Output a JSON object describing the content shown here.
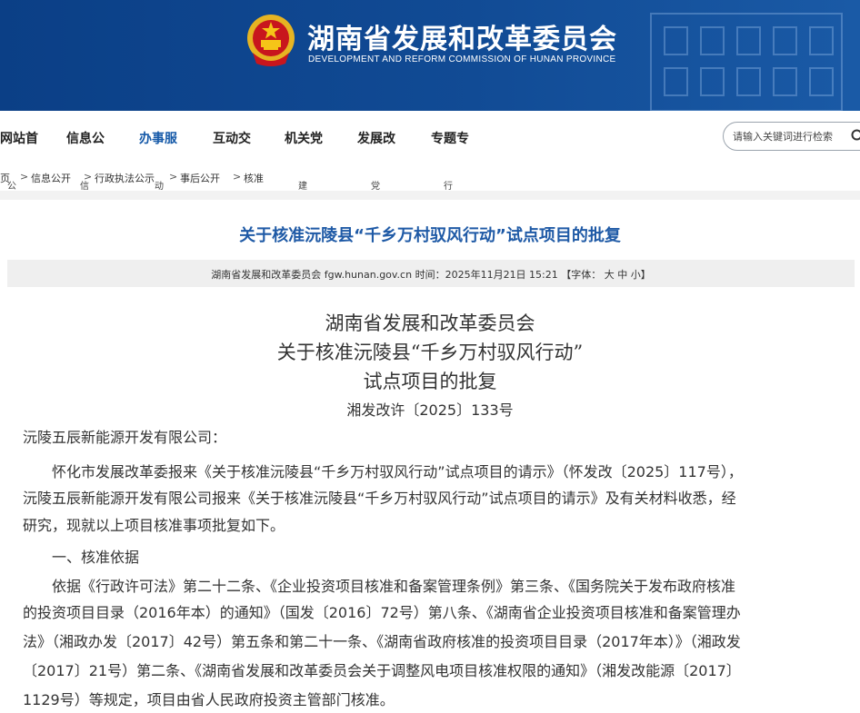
{
  "header": {
    "title": "湖南省发展和改革委员会",
    "subtitle": "DEVELOPMENT AND REFORM COMMISSION OF HUNAN PROVINCE",
    "brand_color": "#0b3f86"
  },
  "nav": {
    "items": [
      "网站首",
      "信息公",
      "办事服",
      "互动交",
      "机关党",
      "发展改",
      "专题专"
    ],
    "active_index": 2,
    "search_placeholder": "请输入关键词进行检索"
  },
  "breadcrumb": {
    "items": [
      "页",
      "信息公开",
      "行政执法公示",
      "事后公开",
      "核准"
    ],
    "separator": ">",
    "ghost": [
      "公",
      "信",
      "动",
      "建",
      "党",
      "行"
    ]
  },
  "article": {
    "title": "关于核准沅陵县“千乡万村驭风行动”试点项目的批复",
    "meta": "湖南省发展和改革委员会 fgw.hunan.gov.cn  时间：2025年11月21日 15:21   【字体：  大  中  小】",
    "doc_heading": [
      "湖南省发展和改革委员会",
      "关于核准沅陵县“千乡万村驭风行动”",
      "试点项目的批复"
    ],
    "doc_number": "湘发改许〔2025〕133号",
    "addressee": "沅陵五辰新能源开发有限公司：",
    "para1": [
      "怀化市发展改革委报来《关于核准沅陵县“千乡万村驭风行动”试点项目的请示》（怀发改〔2025〕117号），",
      "沅陵五辰新能源开发有限公司报来《关于核准沅陵县“千乡万村驭风行动”试点项目的请示》及有关材料收悉，经",
      "研究，现就以上项目核准事项批复如下。"
    ],
    "section1": "一、核准依据",
    "para2": [
      "依据《行政许可法》第二十二条、《企业投资项目核准和备案管理条例》第三条、《国务院关于发布政府核准",
      "的投资项目目录（2016年本）的通知》（国发〔2016〕72号）第八条、《湖南省企业投资项目核准和备案管理办",
      "法》（湘政办发〔2017〕42号）第五条和第二十一条、《湖南省政府核准的投资项目目录（2017年本）》（湘政发",
      "〔2017〕21号）第二条、《湖南省发展和改革委员会关于调整风电项目核准权限的通知》（湘发改能源〔2017〕",
      "1129号）等规定，项目由省人民政府投资主管部门核准。"
    ]
  }
}
